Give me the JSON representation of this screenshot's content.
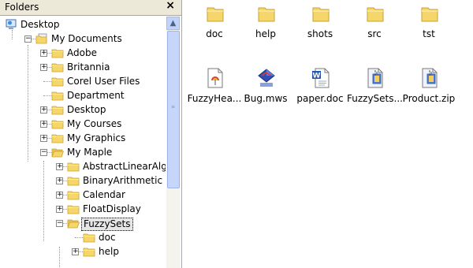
{
  "tree_pane": {
    "title": "Folders",
    "close_glyph": "×",
    "expander_plus": "+",
    "expander_minus": "−",
    "scroll_up_glyph": "▲",
    "scroll_grip": "≡"
  },
  "tree": [
    {
      "label": "Desktop",
      "icon": "desktop-icon",
      "expander": "none"
    },
    {
      "label": "My Documents",
      "icon": "my-documents-icon",
      "expander": "minus"
    },
    {
      "label": "Adobe",
      "icon": "folder-icon",
      "expander": "plus"
    },
    {
      "label": "Britannia",
      "icon": "folder-icon",
      "expander": "plus"
    },
    {
      "label": "Corel User Files",
      "icon": "folder-icon",
      "expander": "none"
    },
    {
      "label": "Department",
      "icon": "folder-icon",
      "expander": "none"
    },
    {
      "label": "Desktop",
      "icon": "folder-icon",
      "expander": "plus"
    },
    {
      "label": "My Courses",
      "icon": "folder-icon",
      "expander": "plus"
    },
    {
      "label": "My Graphics",
      "icon": "folder-icon",
      "expander": "plus"
    },
    {
      "label": "My Maple",
      "icon": "folder-open-icon",
      "expander": "minus"
    },
    {
      "label": "AbstractLinearAlgebra",
      "icon": "folder-icon",
      "expander": "plus"
    },
    {
      "label": "BinaryArithmetic",
      "icon": "folder-icon",
      "expander": "plus"
    },
    {
      "label": "Calendar",
      "icon": "folder-icon",
      "expander": "plus"
    },
    {
      "label": "FloatDisplay",
      "icon": "folder-icon",
      "expander": "plus"
    },
    {
      "label": "FuzzySets",
      "icon": "folder-open-icon",
      "expander": "minus",
      "selected": true
    },
    {
      "label": "doc",
      "icon": "folder-icon",
      "expander": "none"
    },
    {
      "label": "help",
      "icon": "folder-icon",
      "expander": "plus"
    }
  ],
  "files": [
    {
      "label": "doc",
      "icon": "folder-icon"
    },
    {
      "label": "help",
      "icon": "folder-icon"
    },
    {
      "label": "shots",
      "icon": "folder-icon"
    },
    {
      "label": "src",
      "icon": "folder-icon"
    },
    {
      "label": "tst",
      "icon": "folder-icon"
    },
    {
      "label": "FuzzyHea...",
      "icon": "maple-help-file-icon"
    },
    {
      "label": "Bug.mws",
      "icon": "maple-worksheet-icon"
    },
    {
      "label": "paper.doc",
      "icon": "word-document-icon"
    },
    {
      "label": "FuzzySets...",
      "icon": "zip-archive-icon"
    },
    {
      "label": "Product.zip",
      "icon": "zip-archive-icon"
    }
  ],
  "colors": {
    "folder_fill": "#f5d66a",
    "folder_stroke": "#c9a233",
    "selection_bg": "#e6e6e6",
    "pane_header_bg": "#ece9d8"
  }
}
